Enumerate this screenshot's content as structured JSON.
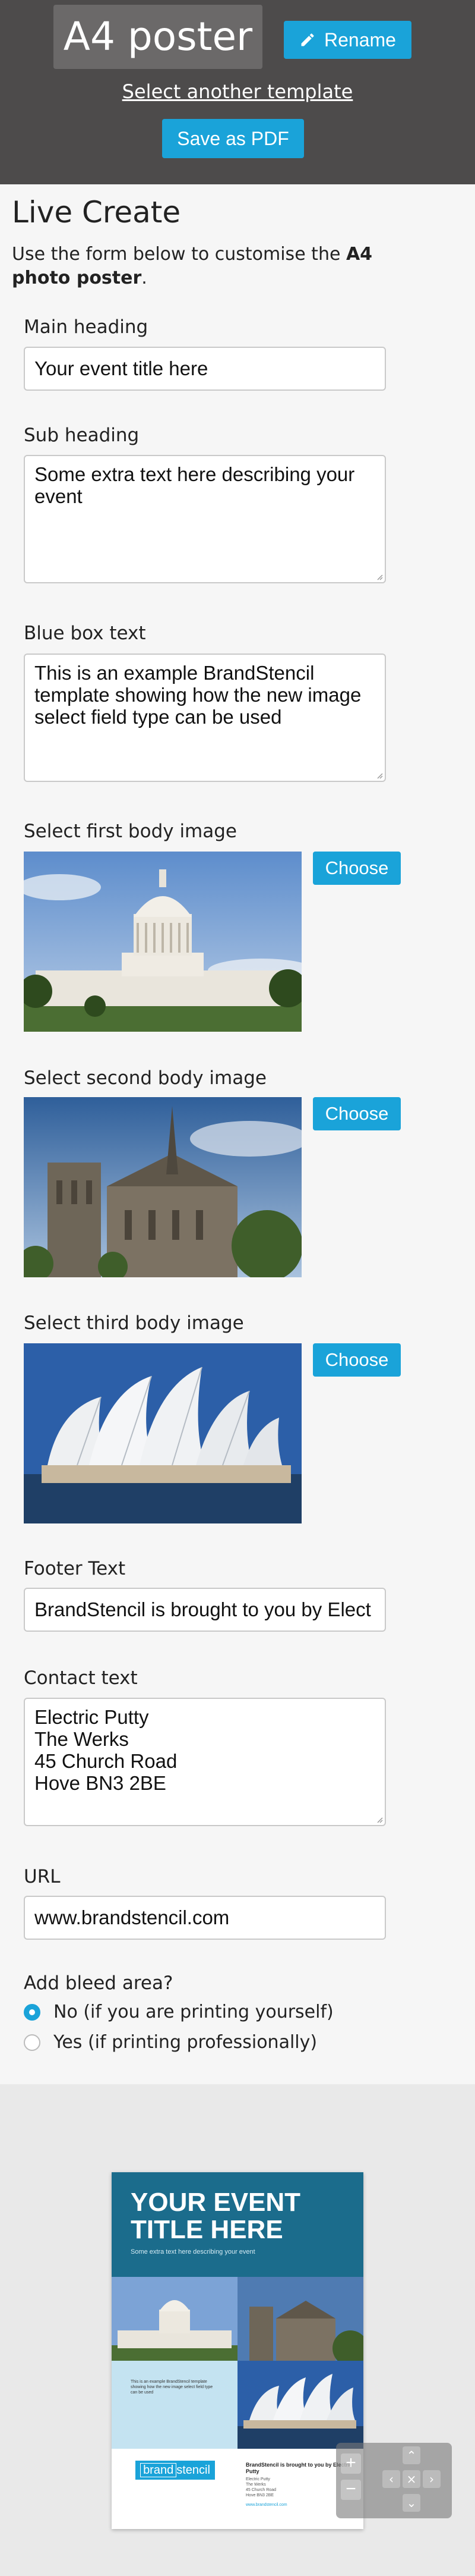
{
  "header": {
    "title": "A4 poster",
    "rename_label": "Rename",
    "another_template": "Select another template",
    "save_pdf": "Save as PDF"
  },
  "form": {
    "title": "Live Create",
    "intro_prefix": "Use the form below to customise the ",
    "intro_bold": "A4 photo poster",
    "intro_suffix": ".",
    "main_heading": {
      "label": "Main heading",
      "value": "Your event title here"
    },
    "sub_heading": {
      "label": "Sub heading",
      "value": "Some extra text here describing your event"
    },
    "blue_box": {
      "label": "Blue box text",
      "value": "This is an example BrandStencil template showing how the new image select field type can be used"
    },
    "image1": {
      "label": "Select first body image",
      "button": "Choose"
    },
    "image2": {
      "label": "Select second body image",
      "button": "Choose"
    },
    "image3": {
      "label": "Select third body image",
      "button": "Choose"
    },
    "footer": {
      "label": "Footer Text",
      "value": "BrandStencil is brought to you by Elect"
    },
    "contact": {
      "label": "Contact text",
      "value": "Electric Putty\nThe Werks\n45 Church Road\nHove BN3 2BE"
    },
    "url": {
      "label": "URL",
      "value": "www.brandstencil.com"
    },
    "bleed": {
      "label": "Add bleed area?",
      "options": [
        "No (if you are printing yourself)",
        "Yes (if printing professionally)"
      ],
      "selected": 0
    }
  },
  "preview": {
    "title": "YOUR EVENT TITLE HERE",
    "subtitle": "Some extra text here describing your event",
    "blue_text": "This is an example BrandStencil template showing how the new image select field type can be used",
    "logo_brand": "brand",
    "logo_stencil": "stencil",
    "footer": "BrandStencil is brought to you by Electric Putty",
    "contact": "Electric Putty\nThe Werks\n45 Church Road\nHove BN3 2BE",
    "url": "www.brandstencil.com",
    "zoom_in": "+",
    "zoom_out": "−",
    "pan_up": "⌃",
    "pan_down": "⌄",
    "pan_left": "‹",
    "pan_right": "›",
    "pan_reset": "×"
  },
  "colors": {
    "accent": "#1aa3d9",
    "header_bg": "#4d4b4b",
    "poster_header": "#1b6c8c",
    "blue_box": "#c4e3f1"
  }
}
